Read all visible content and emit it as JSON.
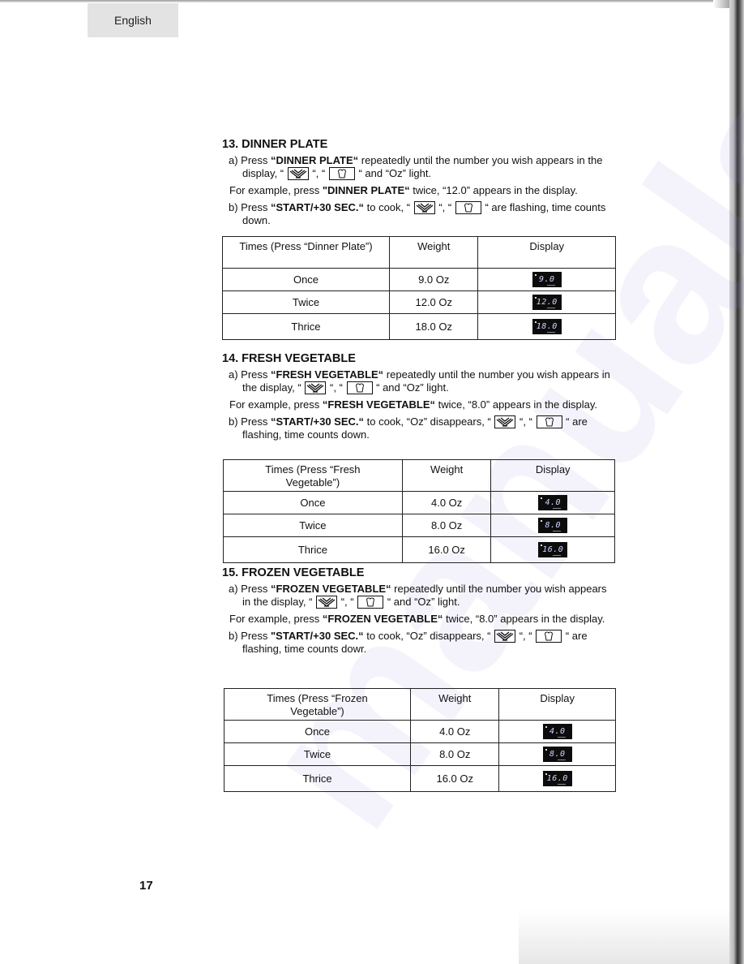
{
  "header": {
    "language_tab": "English"
  },
  "watermark": "manualshive.com",
  "sections": [
    {
      "title": "13. DINNER PLATE",
      "step_a": {
        "prefix": "a) Press ",
        "button": "“DINNER PLATE“",
        "text1": " repeatedly until the number you wish appears in the display, “",
        "sep": "“, “",
        "text2": "“ and “Oz”  light."
      },
      "example": {
        "prefix": "For example, press ",
        "button": "\"DINNER PLATE“",
        "suffix": " twice, “12.0” appears in the display."
      },
      "step_b": {
        "prefix": "b) Press ",
        "button": "“START/+30 SEC.“",
        "text1": " to cook, “",
        "sep": "“, “",
        "text2": "“ are flashing, time counts down."
      },
      "table": {
        "headers": [
          "Times (Press “Dinner Plate”)",
          "Weight",
          "Display"
        ],
        "rows": [
          {
            "times": "Once",
            "weight": "9.0 Oz",
            "display": "9.0"
          },
          {
            "times": "Twice",
            "weight": "12.0 Oz",
            "display": "12.0"
          },
          {
            "times": "Thrice",
            "weight": "18.0 Oz",
            "display": "18.0"
          }
        ]
      }
    },
    {
      "title": "14. FRESH VEGETABLE",
      "step_a": {
        "prefix": "a) Press ",
        "button": "“FRESH VEGETABLE“",
        "text1": " repeatedly until the number you wish appears in the display, “",
        "sep": "“, “",
        "text2": "“ and “Oz” light."
      },
      "example": {
        "prefix": "For example, press ",
        "button": "“FRESH VEGETABLE“",
        "suffix": " twice, “8.0” appears in the display."
      },
      "step_b": {
        "prefix": "b) Press ",
        "button": "“START/+30 SEC.“",
        "text1": " to cook, “Oz” disappears, “",
        "sep": "“, “",
        "text2": "“ are flashing, time counts down."
      },
      "table": {
        "headers": [
          "Times (Press “Fresh Vegetable”)",
          "Weight",
          "Display"
        ],
        "rows": [
          {
            "times": "Once",
            "weight": "4.0 Oz",
            "display": "4.0"
          },
          {
            "times": "Twice",
            "weight": "8.0 Oz",
            "display": "8.0"
          },
          {
            "times": "Thrice",
            "weight": "16.0 Oz",
            "display": "16.0"
          }
        ]
      }
    },
    {
      "title": "15. FROZEN VEGETABLE",
      "step_a": {
        "prefix": "a) Press ",
        "button": "“FROZEN VEGETABLE“",
        "text1": " repeatedly until the number you wish appears in the display, “",
        "sep": "“, “",
        "text2": "“ and “Oz” light."
      },
      "example": {
        "prefix": "For example, press ",
        "button": "“FROZEN VEGETABLE“",
        "suffix": " twice,  “8.0” appears in the display."
      },
      "step_b": {
        "prefix": "b) Press ",
        "button": "\"START/+30 SEC.“",
        "text1": " to cook, “Oz” disappears, “",
        "sep": "“, “",
        "text2": "“ are flashing, time counts dowr."
      },
      "table": {
        "headers": [
          "Times (Press “Frozen Vegetable”)",
          "Weight",
          "Display"
        ],
        "rows": [
          {
            "times": "Once",
            "weight": "4.0 Oz",
            "display": "4.0"
          },
          {
            "times": "Twice",
            "weight": "8.0 Oz",
            "display": "8.0"
          },
          {
            "times": "Thrice",
            "weight": "16.0 Oz",
            "display": "16.0"
          }
        ]
      }
    }
  ],
  "footer": {
    "page_number": "17"
  },
  "icons": {
    "plate": "dinner-plate-icon",
    "veg": "vegetable-bowl-icon"
  }
}
